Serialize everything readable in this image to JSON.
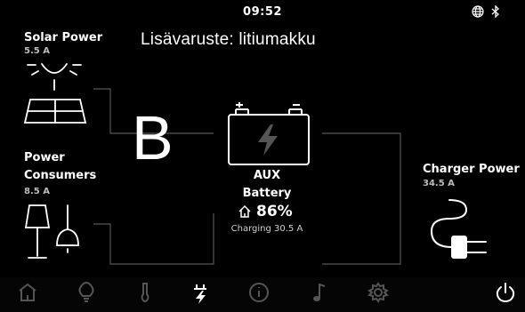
{
  "status": {
    "time": "09:52",
    "icons": [
      "globe-icon",
      "bluetooth-icon"
    ]
  },
  "overlay_title": "Lisävaruste: litiumakku",
  "overlay_letter": "B",
  "solar": {
    "label": "Solar Power",
    "value": "5.5 A"
  },
  "consumers": {
    "label_line1": "Power",
    "label_line2": "Consumers",
    "value": "8.5 A"
  },
  "battery": {
    "line1": "AUX",
    "line2": "Battery",
    "percent": "86%",
    "status": "Charging 30.5 A"
  },
  "charger": {
    "label": "Charger Power",
    "value": "34.5 A"
  },
  "nav": {
    "items": [
      "home-icon",
      "lightbulb-icon",
      "thermometer-icon",
      "power-icon",
      "info-icon",
      "music-icon",
      "settings-icon"
    ],
    "active": "power-icon",
    "power_button": "power-button-icon"
  },
  "colors": {
    "background": "#000000",
    "line": "#555555",
    "text": "#ffffff",
    "subtext": "#bdbdbd",
    "nav_inactive": "#555555"
  }
}
